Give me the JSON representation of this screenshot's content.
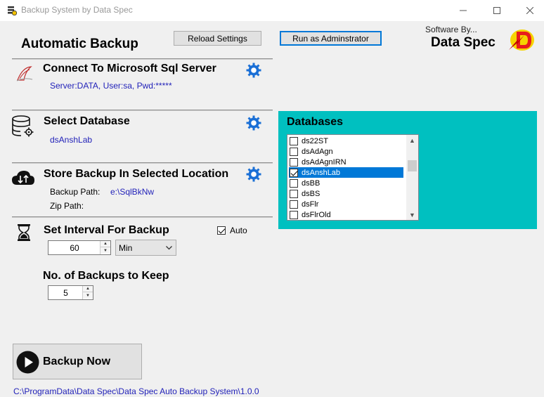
{
  "window": {
    "title": "Backup System by Data Spec"
  },
  "header": {
    "heading": "Automatic Backup",
    "reload_label": "Reload Settings",
    "admin_label": "Run as Adminstrator",
    "software_by": "Software By...",
    "brand": "Data Spec"
  },
  "sql_server": {
    "title": "Connect To Microsoft Sql Server",
    "connection": "Server:DATA, User:sa, Pwd:*****"
  },
  "database": {
    "title": "Select Database",
    "selected": "dsAnshLab"
  },
  "store": {
    "title": "Store Backup In Selected Location",
    "backup_path_label": "Backup Path:",
    "backup_path_value": "e:\\SqlBkNw",
    "zip_path_label": "Zip Path:"
  },
  "interval": {
    "title": "Set Interval For Backup",
    "auto_label": "Auto",
    "auto_checked": true,
    "value": "60",
    "unit": "Min"
  },
  "keep": {
    "title": "No. of Backups to Keep",
    "value": "5"
  },
  "databases_panel": {
    "title": "Databases",
    "items": [
      {
        "label": "ds22ST",
        "checked": false,
        "selected": false
      },
      {
        "label": "dsAdAgn",
        "checked": false,
        "selected": false
      },
      {
        "label": "dsAdAgnIRN",
        "checked": false,
        "selected": false
      },
      {
        "label": "dsAnshLab",
        "checked": true,
        "selected": true
      },
      {
        "label": "dsBB",
        "checked": false,
        "selected": false
      },
      {
        "label": "dsBS",
        "checked": false,
        "selected": false
      },
      {
        "label": "dsFlr",
        "checked": false,
        "selected": false
      },
      {
        "label": "dsFlrOld",
        "checked": false,
        "selected": false
      }
    ]
  },
  "actions": {
    "backup_now_label": "Backup Now"
  },
  "footer": {
    "path": "C:\\ProgramData\\Data Spec\\Data Spec Auto Backup System\\1.0.0"
  },
  "colors": {
    "panel": "#00c0c0",
    "link": "#1f1fb8",
    "selection": "#0078d7",
    "gear": "#1a6fd6"
  },
  "icons": [
    "app-icon",
    "minimize-icon",
    "maximize-icon",
    "close-icon",
    "data-spec-logo",
    "sql-server-icon",
    "gear-icon",
    "database-icon",
    "cloud-icon",
    "hourglass-icon",
    "play-icon",
    "chevron-down-icon"
  ]
}
